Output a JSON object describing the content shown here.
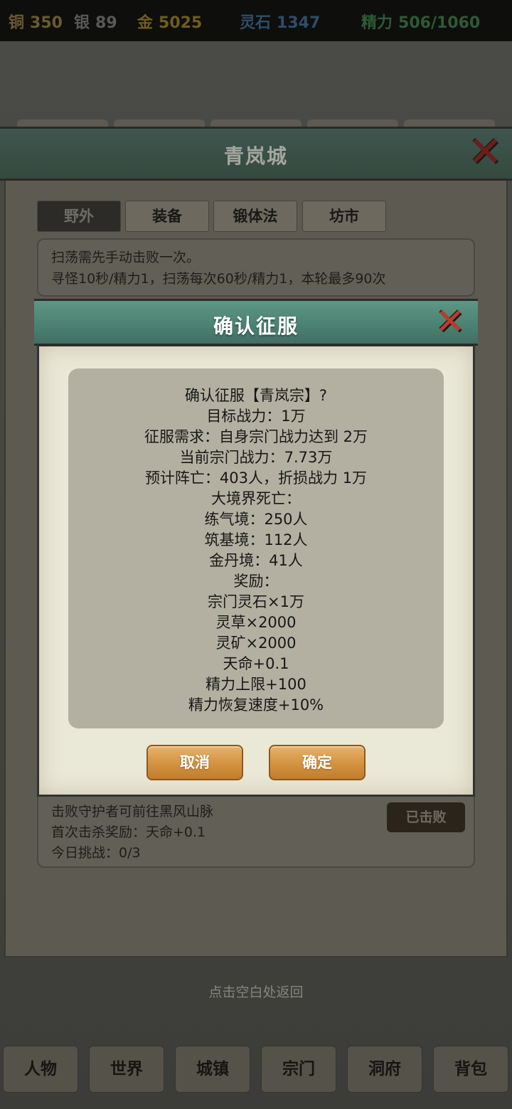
{
  "resources": {
    "copper": {
      "label": "铜",
      "value": "350"
    },
    "silver": {
      "label": "银",
      "value": "89"
    },
    "gold": {
      "label": "金",
      "value": "5025"
    },
    "spirit_stone": {
      "label": "灵石",
      "value": "1347"
    },
    "energy": {
      "label": "精力",
      "value": "506/1060"
    }
  },
  "city": {
    "title": "青岚城",
    "tabs": [
      {
        "label": "野外",
        "active": true
      },
      {
        "label": "装备",
        "active": false
      },
      {
        "label": "锻体法",
        "active": false
      },
      {
        "label": "坊市",
        "active": false
      }
    ],
    "info_lines": [
      "扫荡需先手动击败一次。",
      "寻怪10秒/精力1，扫荡每次60秒/精力1，本轮最多90次"
    ],
    "boss": {
      "lines": [
        "击败守护者可前往黑风山脉",
        "首次击杀奖励：天命+0.1",
        "今日挑战：0/3"
      ],
      "status_button": "已击败"
    },
    "back_hint": "点击空白处返回"
  },
  "dialog": {
    "title": "确认征服",
    "lines": [
      "确认征服【青岚宗】?",
      "目标战力：1万",
      "征服需求：自身宗门战力达到 2万",
      "当前宗门战力：7.73万",
      "预计阵亡：403人，折损战力 1万",
      "大境界死亡：",
      "练气境：250人",
      "筑基境：112人",
      "金丹境：41人",
      "奖励：",
      "宗门灵石×1万",
      "灵草×2000",
      "灵矿×2000",
      "天命+0.1",
      "精力上限+100",
      "精力恢复速度+10%"
    ],
    "cancel_label": "取消",
    "confirm_label": "确定"
  },
  "bottom_nav": [
    "人物",
    "世界",
    "城镇",
    "宗门",
    "洞府",
    "背包"
  ],
  "colors": {
    "dialog_header": "#4c8273",
    "dialog_paper": "#eae8d7",
    "button_orange": "#d3923f",
    "close_red": "#c0392b"
  },
  "icons": {
    "close": "close-x-icon"
  }
}
